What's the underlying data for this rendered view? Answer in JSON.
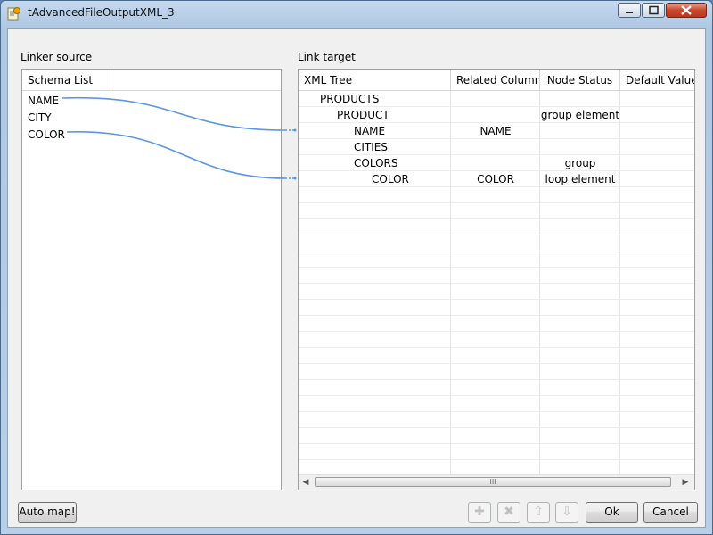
{
  "window": {
    "title": "tAdvancedFileOutputXML_3"
  },
  "source": {
    "group_label": "Linker source",
    "column_header": "Schema List",
    "items": [
      "NAME",
      "CITY",
      "COLOR"
    ]
  },
  "target": {
    "group_label": "Link target",
    "headers": [
      "XML Tree",
      "Related Column",
      "Node Status",
      "Default Value"
    ],
    "rows": [
      {
        "tree": "PRODUCTS",
        "related": "",
        "status": "",
        "default": ""
      },
      {
        "tree": "PRODUCT",
        "related": "",
        "status": "group element",
        "default": ""
      },
      {
        "tree": "NAME",
        "related": "NAME",
        "status": "",
        "default": ""
      },
      {
        "tree": "CITIES",
        "related": "",
        "status": "",
        "default": ""
      },
      {
        "tree": "COLORS",
        "related": "",
        "status": "group",
        "default": ""
      },
      {
        "tree": "COLOR",
        "related": "COLOR",
        "status": "loop element",
        "default": ""
      }
    ],
    "scroll_grip": "III"
  },
  "buttons": {
    "auto_map": "Auto map!",
    "ok": "Ok",
    "cancel": "Cancel",
    "add_icon": "✚",
    "remove_icon": "✖",
    "up_icon": "⇧",
    "down_icon": "⇩"
  },
  "colors": {
    "link_line": "#5b95e6",
    "accent": "#c8462a"
  }
}
